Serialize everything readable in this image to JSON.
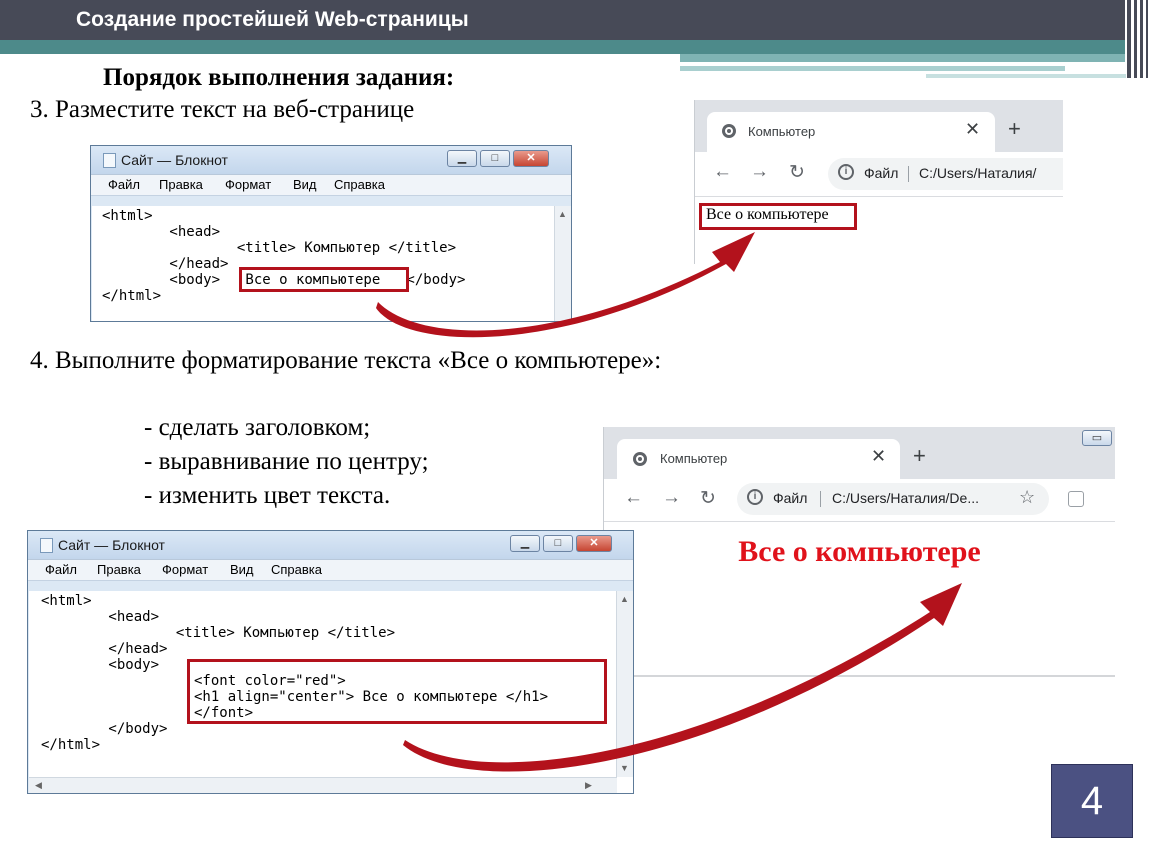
{
  "slide": {
    "title": "Создание простейшей Web-страницы",
    "heading": "Порядок выполнения задания:",
    "step3": "3. Разместите текст на веб-странице",
    "step4": "4. Выполните форматирование текста «Все о компьютере»:",
    "bullets": [
      "- сделать заголовком;",
      "- выравнивание по центру;",
      "- изменить цвет текста."
    ],
    "page_number": "4"
  },
  "notepad1": {
    "title": "Сайт — Блокнот",
    "menu": [
      "Файл",
      "Правка",
      "Формат",
      "Вид",
      "Справка"
    ],
    "lines": [
      "<html>",
      "        <head>",
      "                <title> Компьютер </title>",
      "        </head>",
      "        <body>",
      " Все о компьютере ",
      " </body>",
      "</html>"
    ]
  },
  "browser1": {
    "tab_title": "Компьютер",
    "address_label": "Файл",
    "address": "C:/Users/Наталия/",
    "content": "Все о компьютере"
  },
  "browser2": {
    "tab_title": "Компьютер",
    "address_label": "Файл",
    "address": "C:/Users/Наталия/De...",
    "content": "Все о компьютере",
    "content_color": "#e0121b"
  },
  "notepad2": {
    "title": "Сайт — Блокнот",
    "menu": [
      "Файл",
      "Правка",
      "Формат",
      "Вид",
      "Справка"
    ],
    "lines": [
      "<html>",
      "        <head>",
      "                <title> Компьютер </title>",
      "        </head>",
      "        <body>",
      "<font color=\"red\">",
      "<h1 align=\"center\"> Все о компьютере </h1>",
      "</font>",
      "        </body>",
      "</html>"
    ]
  },
  "colors": {
    "header_bg": "#474a57",
    "accent_teal": "#4d8a8a",
    "highlight_red": "#b3121c",
    "page_number_bg": "#4b5182"
  }
}
